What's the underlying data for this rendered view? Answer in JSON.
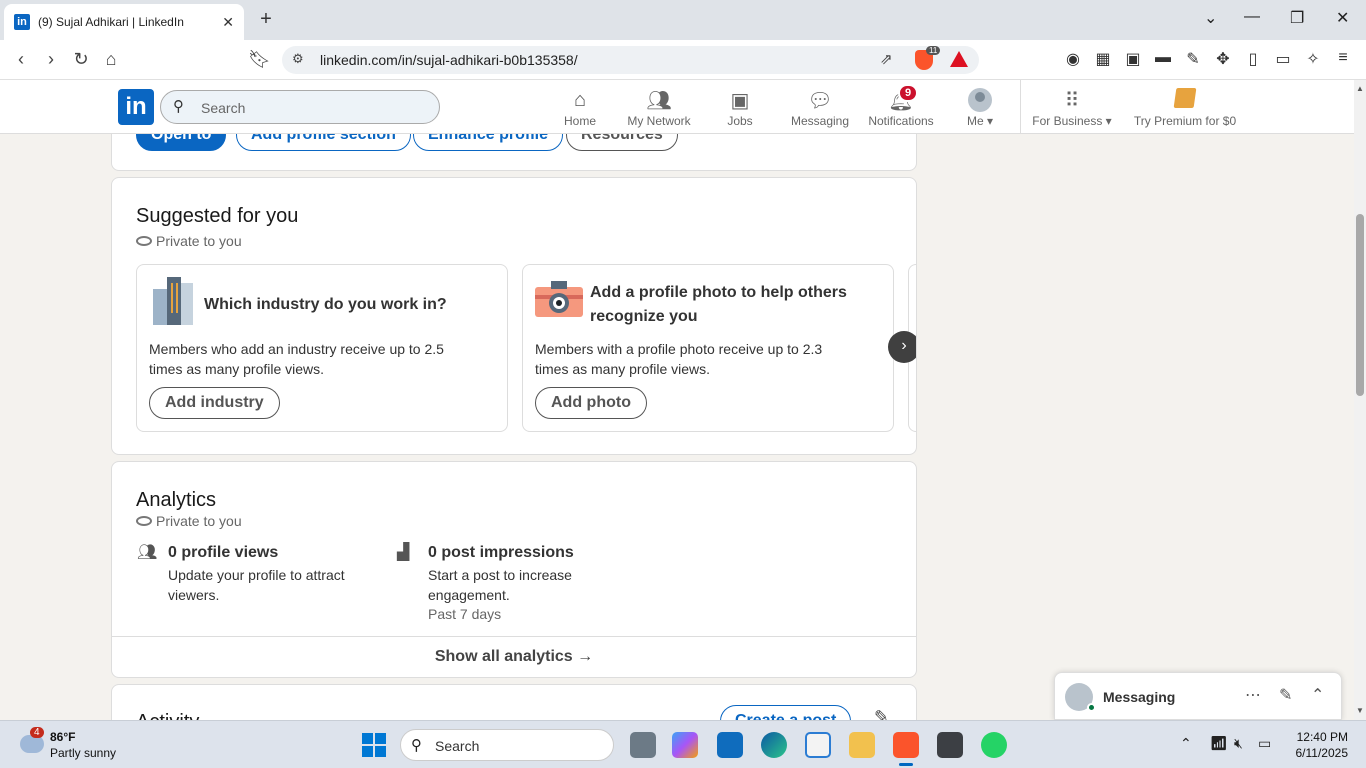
{
  "browser": {
    "tab_title": "(9) Sujal Adhikari | LinkedIn",
    "tab_favicon_text": "in",
    "url": "linkedin.com/in/sujal-adhikari-b0b135358/",
    "brave_badge": "11"
  },
  "linkedin_nav": {
    "logo_text": "in",
    "search_placeholder": "Search",
    "items": [
      {
        "label": "Home",
        "icon": "home-icon"
      },
      {
        "label": "My Network",
        "icon": "network-icon"
      },
      {
        "label": "Jobs",
        "icon": "briefcase-icon"
      },
      {
        "label": "Messaging",
        "icon": "chat-icon"
      },
      {
        "label": "Notifications",
        "icon": "bell-icon",
        "badge": "9"
      },
      {
        "label": "Me",
        "icon": "avatar"
      }
    ],
    "for_business": "For Business",
    "premium": "Try Premium for $0"
  },
  "top_card": {
    "buttons": [
      "Open to",
      "Add profile section",
      "Enhance profile",
      "Resources"
    ]
  },
  "suggested": {
    "title": "Suggested for you",
    "privacy": "Private to you",
    "cards": [
      {
        "title": "Which industry do you work in?",
        "description": "Members who add an industry receive up to 2.5 times as many profile views.",
        "button": "Add industry"
      },
      {
        "title": "Add a profile photo to help others recognize you",
        "description": "Members with a profile photo receive up to 2.3 times as many profile views.",
        "button": "Add photo"
      }
    ],
    "next_arrow": "›"
  },
  "analytics": {
    "title": "Analytics",
    "privacy": "Private to you",
    "items": [
      {
        "title": "0 profile views",
        "description": "Update your profile to attract viewers."
      },
      {
        "title": "0 post impressions",
        "description": "Start a post to increase engagement.",
        "meta": "Past 7 days"
      }
    ],
    "show_all": "Show all analytics →"
  },
  "activity": {
    "title": "Activity",
    "create_post": "Create a post"
  },
  "messaging_dock": {
    "label": "Messaging"
  },
  "taskbar": {
    "weather_badge": "4",
    "weather_temp": "86°F",
    "weather_desc": "Partly sunny",
    "search_placeholder": "Search",
    "time": "12:40 PM",
    "date": "6/11/2025"
  }
}
